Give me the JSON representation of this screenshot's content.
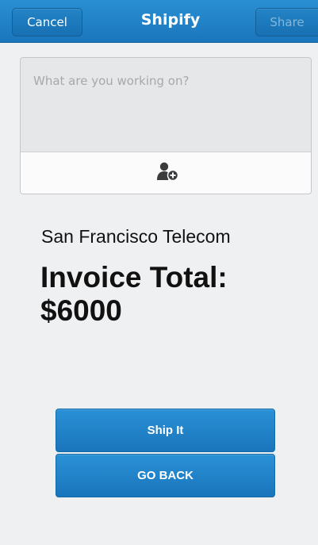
{
  "header": {
    "title": "Shipify",
    "cancel_label": "Cancel",
    "share_label": "Share"
  },
  "compose": {
    "placeholder": "What are you working on?",
    "value": "",
    "icon": "add-person-icon"
  },
  "invoice": {
    "company": "San Francisco Telecom",
    "total_label": "Invoice Total:",
    "total_value": "$6000"
  },
  "actions": {
    "ship_label": "Ship It",
    "back_label": "GO BACK"
  },
  "colors": {
    "accent": "#1f80c6",
    "background": "#eff0f2"
  }
}
